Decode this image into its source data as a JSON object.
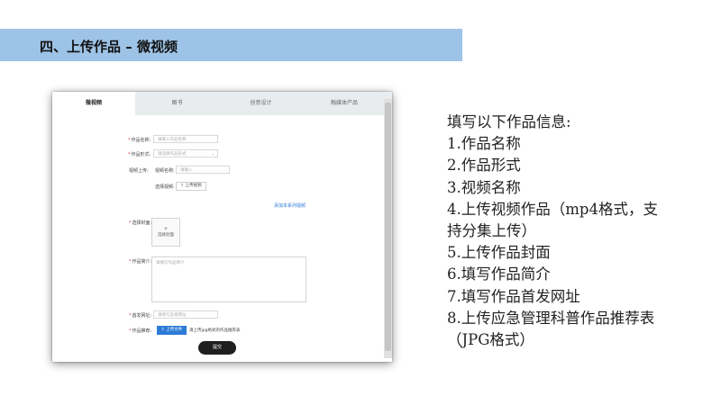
{
  "slide": {
    "header": "四、上传作品 – 微视频"
  },
  "form": {
    "tabs": [
      "微视频",
      "图书",
      "创意设计",
      "融媒体产品"
    ],
    "fields": {
      "work_name_label": "作品名称:",
      "work_name_placeholder": "请输入作品名称",
      "work_form_label": "作品形式:",
      "work_form_placeholder": "请选择作品形式",
      "video_upload_label": "视频上传:",
      "video_name_label": "视频名称:",
      "video_name_placeholder": "请输入",
      "select_video_label": "选择视频:",
      "upload_video_button": "上传视频",
      "add_series_link": "添加本系列视频",
      "cover_label": "选择封面:",
      "cover_plus": "+",
      "cover_text": "选择封面",
      "intro_label": "作品简介:",
      "intro_placeholder": "请填写作品简介",
      "url_label": "首发网址:",
      "url_placeholder": "请填写首发网址",
      "recommend_label": "作品推荐:",
      "upload_file_button": "上传文件",
      "upload_hint": "请上传jpg格式的作品推荐表",
      "submit_button": "提交"
    }
  },
  "instructions": {
    "lines": [
      "填写以下作品信息:",
      "1.作品名称",
      "2.作品形式",
      "3.视频名称",
      "4.上传视频作品（mp4格式，支",
      "持分集上传）",
      "5.上传作品封面",
      "6.填写作品简介",
      "7.填写作品首发网址",
      "8.上传应急管理科普作品推荐表",
      "（JPG格式）"
    ]
  }
}
